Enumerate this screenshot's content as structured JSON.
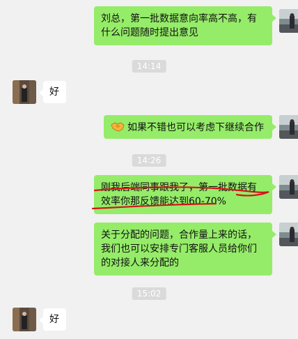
{
  "messages": [
    {
      "side": "right",
      "text": "刘总，第一批数据意向率高不高，有什么问题随时提出意见"
    },
    {
      "side": "left",
      "text": "好"
    },
    {
      "side": "right",
      "icon": "handshake-icon",
      "text": "如果不错也可以考虑下继续合作"
    },
    {
      "side": "right",
      "text": "刚我后端同事跟我了，第一批数据有效率你那反馈能达到60-70%"
    },
    {
      "side": "right",
      "text": "关于分配的问题，合作量上来的话，我们也可以安排专门客服人员给你们的对接人来分配的"
    },
    {
      "side": "left",
      "text": "好"
    }
  ],
  "timestamps": [
    "14:14",
    "14:26",
    "15:02"
  ],
  "colors": {
    "outgoing_bubble": "#95ec69",
    "incoming_bubble": "#ffffff",
    "background": "#f1f1f1",
    "annotation": "#d3151b"
  }
}
